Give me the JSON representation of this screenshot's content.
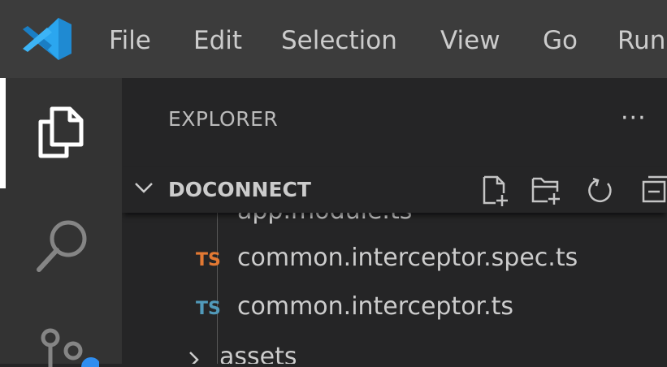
{
  "menubar": {
    "items": [
      "File",
      "Edit",
      "Selection",
      "View",
      "Go",
      "Run"
    ]
  },
  "activity_bar": {
    "icons": [
      "explorer-icon",
      "search-icon",
      "source-control-icon"
    ]
  },
  "sidebar": {
    "title": "EXPLORER",
    "more_actions": "···",
    "section": {
      "title": "DOCONNECT",
      "actions": [
        "new-file-icon",
        "new-folder-icon",
        "refresh-icon",
        "collapse-all-icon"
      ]
    },
    "tree": [
      {
        "name": "app.module.ts",
        "badge": "",
        "kind": "file"
      },
      {
        "name": "common.interceptor.spec.ts",
        "badge": "TS",
        "badge_color": "#e37933",
        "kind": "file"
      },
      {
        "name": "common.interceptor.ts",
        "badge": "TS",
        "badge_color": "#519aba",
        "kind": "file"
      },
      {
        "name": "assets",
        "badge": "",
        "kind": "folder"
      }
    ]
  },
  "colors": {
    "titlebar": "#3c3c3c",
    "activity_bar": "#333333",
    "sidebar": "#252526",
    "vscode_blue": "#23a9f2"
  }
}
